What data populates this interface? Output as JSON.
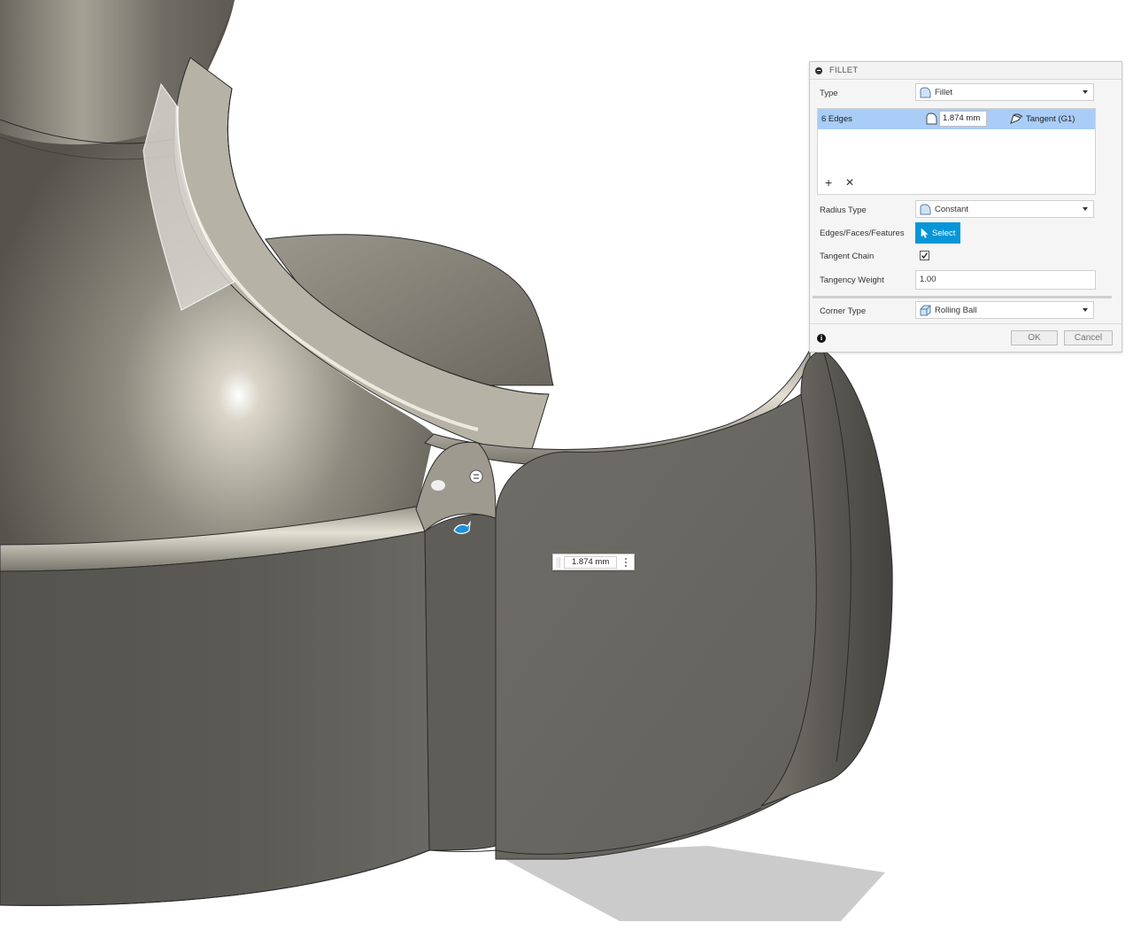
{
  "dialog": {
    "title": "FILLET",
    "type": {
      "label": "Type",
      "value": "Fillet"
    },
    "edges": {
      "selection_label": "6 Edges",
      "radius_value": "1.874 mm",
      "continuity": "Tangent (G1)"
    },
    "radius_type": {
      "label": "Radius Type",
      "value": "Constant"
    },
    "edges_faces_features": {
      "label": "Edges/Faces/Features",
      "button": "Select"
    },
    "tangent_chain": {
      "label": "Tangent Chain",
      "checked": true
    },
    "tangency_weight": {
      "label": "Tangency Weight",
      "value": "1.00"
    },
    "corner_type": {
      "label": "Corner Type",
      "value": "Rolling Ball"
    },
    "ok_label": "OK",
    "cancel_label": "Cancel"
  },
  "canvas": {
    "radius_tag_value": "1.874 mm"
  },
  "colors": {
    "accent": "#0696d7",
    "selection_row": "#a9cdf7",
    "model_body": "#5a5851",
    "model_face": "#6d6b64"
  },
  "icons": [
    "fillet-type-icon",
    "radius-icon",
    "tangent-icon",
    "add-icon",
    "remove-icon",
    "cursor-icon",
    "checkmark-icon",
    "rolling-ball-icon",
    "info-icon",
    "fillet-manipulator-icon",
    "flip-handle-icon"
  ]
}
